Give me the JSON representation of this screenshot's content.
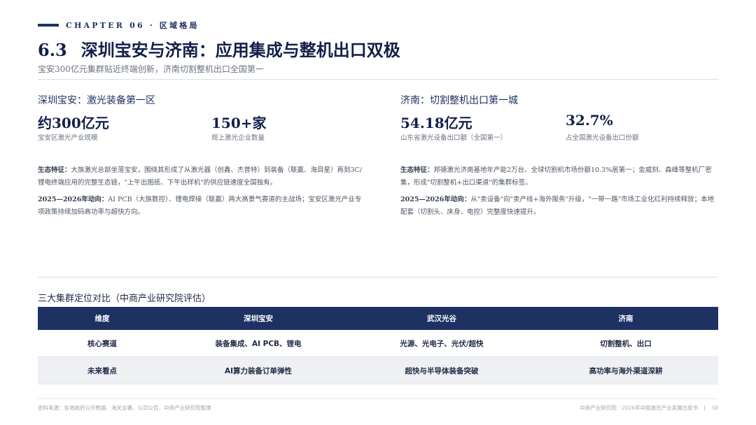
{
  "header": {
    "chapter": "CHAPTER 06 · 区域格局",
    "section_number": "6.3",
    "title": "深圳宝安与济南：应用集成与整机出口双极",
    "subtitle": "宝安300亿元集群贴近终端创新，济南切割整机出口全国第一"
  },
  "left": {
    "heading": "深圳宝安：激光装备第一区",
    "stats": [
      {
        "value": "约300亿元",
        "label": "宝安区激光产业规模"
      },
      {
        "value": "150+家",
        "label": "规上激光企业数量"
      }
    ],
    "para1_lead": "生态特征：",
    "para1_text": "大族激光总部坐落宝安，围绕其形成了从激光器（创鑫、杰普特）到装备（联赢、海目星）再到3C/锂电终端应用的完整生态链，\"上午出图纸、下午出样机\"的供应链速度全国独有。",
    "para2_lead": "2025—2026年动向：",
    "para2_text": "AI PCB（大族数控）、锂电焊接（联赢）两大高景气赛道的主战场；宝安区激光产业专项政策持续加码高功率与超快方向。"
  },
  "right": {
    "heading": "济南：切割整机出口第一城",
    "stats": [
      {
        "value": "54.18亿元",
        "label": "山东省激光设备出口额（全国第一）"
      },
      {
        "value": "32.7%",
        "label": "占全国激光设备出口份额"
      }
    ],
    "para1_lead": "生态特征：",
    "para1_text": "邦德激光济南基地年产能2万台、全球切割机市场份额10.3%居第一；金威刻、森峰等整机厂密集，形成\"切割整机+出口渠道\"的集群标签。",
    "para2_lead": "2025—2026年动向：",
    "para2_text": "从\"卖设备\"向\"卖产线+海外服务\"升级，\"一带一路\"市场工业化红利持续释放；本地配套（切割头、床身、电控）完整度快速提升。"
  },
  "table": {
    "title": "三大集群定位对比（中商产业研究院评估）",
    "headers": [
      "维度",
      "深圳宝安",
      "武汉光谷",
      "济南"
    ],
    "rows": [
      [
        "核心赛道",
        "装备集成、AI PCB、锂电",
        "光源、光电子、光伏/超快",
        "切割整机、出口"
      ],
      [
        "未来看点",
        "AI算力装备订单弹性",
        "超快与半导体装备突破",
        "高功率与海外渠道深耕"
      ]
    ]
  },
  "footer": {
    "source": "资料来源：各地政府公开数据、海关总署、公司公告、中商产业研究院整理",
    "publisher": "中商产业研究院 · 2026年中国激光产业发展白皮书",
    "page": "58"
  }
}
